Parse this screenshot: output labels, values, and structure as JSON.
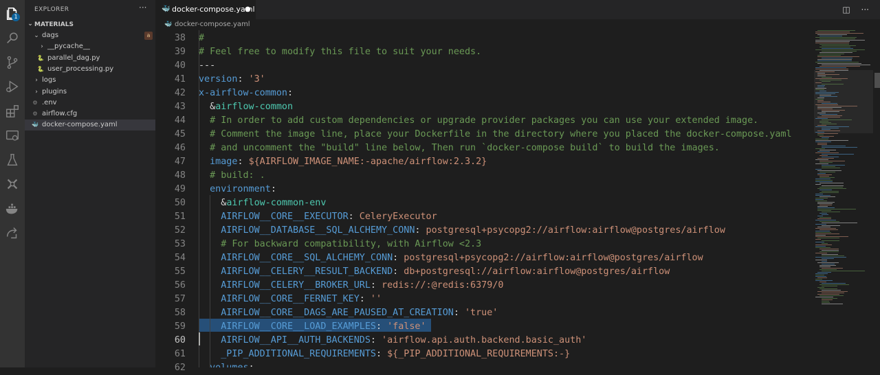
{
  "activity_bar": {
    "badge": "1",
    "icons": [
      "explorer-icon",
      "search-icon",
      "source-control-icon",
      "run-debug-icon",
      "extensions-icon",
      "remote-explorer-icon",
      "testing-icon",
      "kubernetes-icon",
      "docker-icon",
      "live-share-icon"
    ]
  },
  "sidebar": {
    "title": "EXPLORER",
    "more": "···",
    "section": "MATERIALS",
    "items": [
      {
        "label": "dags",
        "kind": "folder-open",
        "depth": 1,
        "badge": "a"
      },
      {
        "label": "__pycache__",
        "kind": "folder",
        "depth": 2
      },
      {
        "label": "parallel_dag.py",
        "kind": "python",
        "depth": 2
      },
      {
        "label": "user_processing.py",
        "kind": "python",
        "depth": 2
      },
      {
        "label": "logs",
        "kind": "folder",
        "depth": 1
      },
      {
        "label": "plugins",
        "kind": "folder",
        "depth": 1
      },
      {
        "label": ".env",
        "kind": "gear",
        "depth": 1
      },
      {
        "label": "airflow.cfg",
        "kind": "gear",
        "depth": 1
      },
      {
        "label": "docker-compose.yaml",
        "kind": "docker",
        "depth": 1,
        "selected": true
      }
    ]
  },
  "tabs": [
    {
      "label": "docker-compose.yaml",
      "active": true,
      "dirty": "●"
    }
  ],
  "editor_actions": {
    "split": "◫",
    "more": "···"
  },
  "breadcrumb": {
    "file": "docker-compose.yaml"
  },
  "editor": {
    "cursor_line": "60",
    "lines": [
      {
        "n": "38",
        "t": [
          [
            "c",
            "#"
          ]
        ]
      },
      {
        "n": "39",
        "t": [
          [
            "c",
            "# Feel free to modify this file to suit your needs."
          ]
        ]
      },
      {
        "n": "40",
        "t": [
          [
            "p",
            "---"
          ]
        ]
      },
      {
        "n": "41",
        "t": [
          [
            "k",
            "version"
          ],
          [
            "p",
            ": "
          ],
          [
            "s",
            "'3'"
          ]
        ]
      },
      {
        "n": "42",
        "t": [
          [
            "k",
            "x-airflow-common"
          ],
          [
            "p",
            ":"
          ]
        ]
      },
      {
        "n": "43",
        "t": [
          [
            "p",
            "  &"
          ],
          [
            "a",
            "airflow-common"
          ]
        ]
      },
      {
        "n": "44",
        "t": [
          [
            "c",
            "  # In order to add custom dependencies or upgrade provider packages you can use your extended image."
          ]
        ]
      },
      {
        "n": "45",
        "t": [
          [
            "c",
            "  # Comment the image line, place your Dockerfile in the directory where you placed the docker-compose.yaml"
          ]
        ]
      },
      {
        "n": "46",
        "t": [
          [
            "c",
            "  # and uncomment the \"build\" line below, Then run `docker-compose build` to build the images."
          ]
        ]
      },
      {
        "n": "47",
        "t": [
          [
            "k",
            "  image"
          ],
          [
            "p",
            ": "
          ],
          [
            "s",
            "${AIRFLOW_IMAGE_NAME:-apache/airflow:2.3.2}"
          ]
        ]
      },
      {
        "n": "48",
        "t": [
          [
            "c",
            "  # build: ."
          ]
        ]
      },
      {
        "n": "49",
        "t": [
          [
            "k",
            "  environment"
          ],
          [
            "p",
            ":"
          ]
        ]
      },
      {
        "n": "50",
        "t": [
          [
            "p",
            "    &"
          ],
          [
            "a",
            "airflow-common-env"
          ]
        ]
      },
      {
        "n": "51",
        "t": [
          [
            "k",
            "    AIRFLOW__CORE__EXECUTOR"
          ],
          [
            "p",
            ": "
          ],
          [
            "s",
            "CeleryExecutor"
          ]
        ]
      },
      {
        "n": "52",
        "t": [
          [
            "k",
            "    AIRFLOW__DATABASE__SQL_ALCHEMY_CONN"
          ],
          [
            "p",
            ": "
          ],
          [
            "s",
            "postgresql+psycopg2://airflow:airflow@postgres/airflow"
          ]
        ]
      },
      {
        "n": "53",
        "t": [
          [
            "c",
            "    # For backward compatibility, with Airflow <2.3"
          ]
        ]
      },
      {
        "n": "54",
        "t": [
          [
            "k",
            "    AIRFLOW__CORE__SQL_ALCHEMY_CONN"
          ],
          [
            "p",
            ": "
          ],
          [
            "s",
            "postgresql+psycopg2://airflow:airflow@postgres/airflow"
          ]
        ]
      },
      {
        "n": "55",
        "t": [
          [
            "k",
            "    AIRFLOW__CELERY__RESULT_BACKEND"
          ],
          [
            "p",
            ": "
          ],
          [
            "s",
            "db+postgresql://airflow:airflow@postgres/airflow"
          ]
        ]
      },
      {
        "n": "56",
        "t": [
          [
            "k",
            "    AIRFLOW__CELERY__BROKER_URL"
          ],
          [
            "p",
            ": "
          ],
          [
            "s",
            "redis://:@redis:6379/0"
          ]
        ]
      },
      {
        "n": "57",
        "t": [
          [
            "k",
            "    AIRFLOW__CORE__FERNET_KEY"
          ],
          [
            "p",
            ": "
          ],
          [
            "s",
            "''"
          ]
        ]
      },
      {
        "n": "58",
        "t": [
          [
            "k",
            "    AIRFLOW__CORE__DAGS_ARE_PAUSED_AT_CREATION"
          ],
          [
            "p",
            ": "
          ],
          [
            "s",
            "'true'"
          ]
        ]
      },
      {
        "n": "59",
        "t": [
          [
            "k",
            "    AIRFLOW__CORE__LOAD_EXAMPLES"
          ],
          [
            "p",
            ": "
          ],
          [
            "s",
            "'false'"
          ]
        ]
      },
      {
        "n": "60",
        "t": [
          [
            "k",
            "    AIRFLOW__API__AUTH_BACKENDS"
          ],
          [
            "p",
            ": "
          ],
          [
            "s",
            "'airflow.api.auth.backend.basic_auth'"
          ]
        ]
      },
      {
        "n": "61",
        "t": [
          [
            "k",
            "    _PIP_ADDITIONAL_REQUIREMENTS"
          ],
          [
            "p",
            ": "
          ],
          [
            "s",
            "${_PIP_ADDITIONAL_REQUIREMENTS:-}"
          ]
        ]
      },
      {
        "n": "62",
        "t": [
          [
            "k",
            "  volumes"
          ],
          [
            "p",
            ":"
          ]
        ]
      }
    ]
  },
  "colors": {
    "keyword": "#569cd6",
    "string": "#ce9178",
    "comment": "#6a9955",
    "anchor": "#4ec9b0",
    "selection": "#264f78"
  }
}
